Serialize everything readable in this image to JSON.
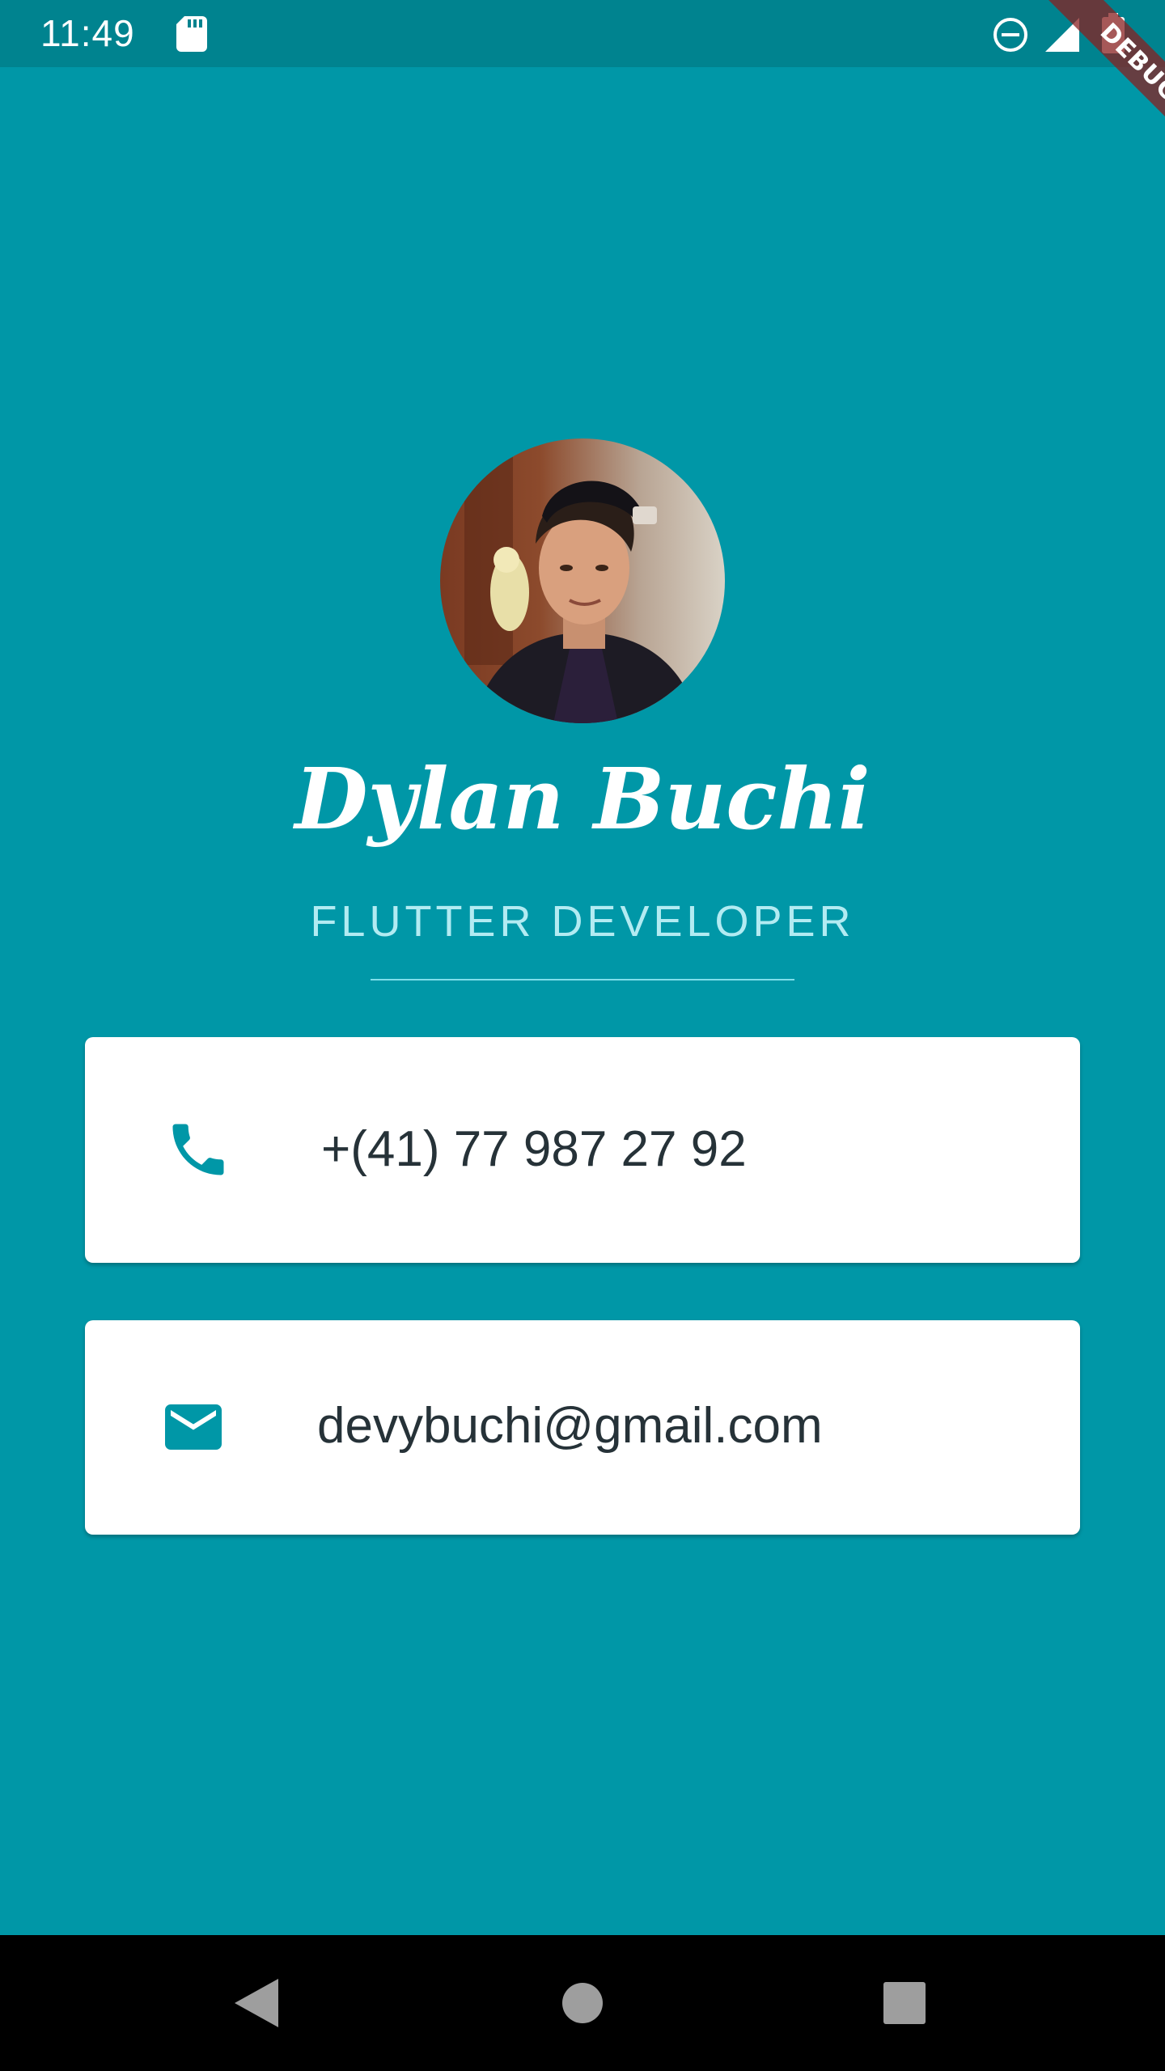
{
  "status_bar": {
    "time": "11:49",
    "icons": [
      "sd-card-icon",
      "do-not-disturb-icon",
      "signal-icon",
      "battery-icon"
    ]
  },
  "debug_banner": {
    "label": "DEBUG"
  },
  "profile": {
    "name": "Dylan Buchi",
    "title": "FLUTTER DEVELOPER"
  },
  "contacts": {
    "phone": {
      "icon": "phone-icon",
      "value": "+(41) 77 987 27 92"
    },
    "email": {
      "icon": "mail-icon",
      "value": "devybuchi@gmail.com"
    }
  },
  "nav_bar": {
    "icons": [
      "back-icon",
      "home-icon",
      "recents-icon"
    ]
  },
  "colors": {
    "background": "#0097A7",
    "status_bar": "#00838F",
    "accent": "#0097A7",
    "title_text": "#B2EBF2",
    "card": "#FFFFFF",
    "nav_bar": "#000000"
  }
}
